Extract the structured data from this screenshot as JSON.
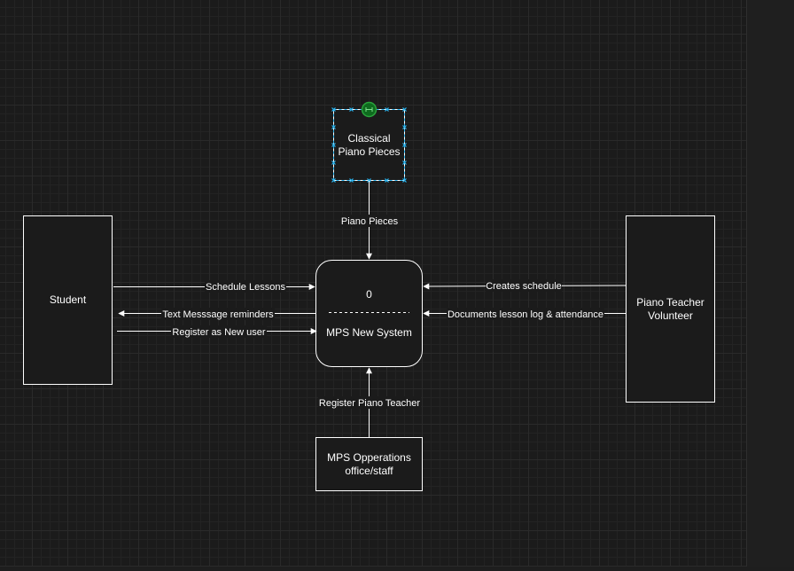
{
  "diagram": {
    "entities": {
      "student": "Student",
      "teacher_line1": "Piano Teacher",
      "teacher_line2": "Volunteer",
      "operations_line1": "MPS Opperations",
      "operations_line2": "office/staff",
      "pieces_line1": "Classical",
      "pieces_line2": "Piano Pieces"
    },
    "process": {
      "number": "0",
      "name": "MPS New System"
    },
    "flows": {
      "piano_pieces": "Piano Pieces",
      "schedule_lessons": "Schedule Lessons",
      "text_reminders": "Text Messsage reminders",
      "register_new_user": "Register as New user",
      "creates_schedule": "Creates schedule",
      "documents_lesson": "Documents lesson log & attendance",
      "register_teacher": "Register Piano Teacher"
    }
  }
}
